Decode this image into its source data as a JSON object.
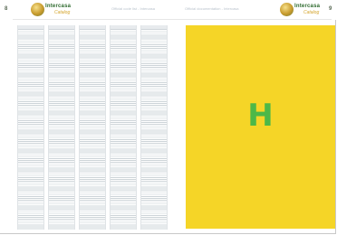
{
  "header": {
    "left_page_number": "8",
    "right_page_number": "9",
    "logo_name": "Intercasa",
    "logo_sub": "Catalog",
    "left_running_text": "Official code list - Intercasa",
    "right_running_text": "Official documentation - Intercasa"
  },
  "divider": {
    "letter": "H",
    "background_color": "#f5d527",
    "letter_color": "#4db848"
  }
}
